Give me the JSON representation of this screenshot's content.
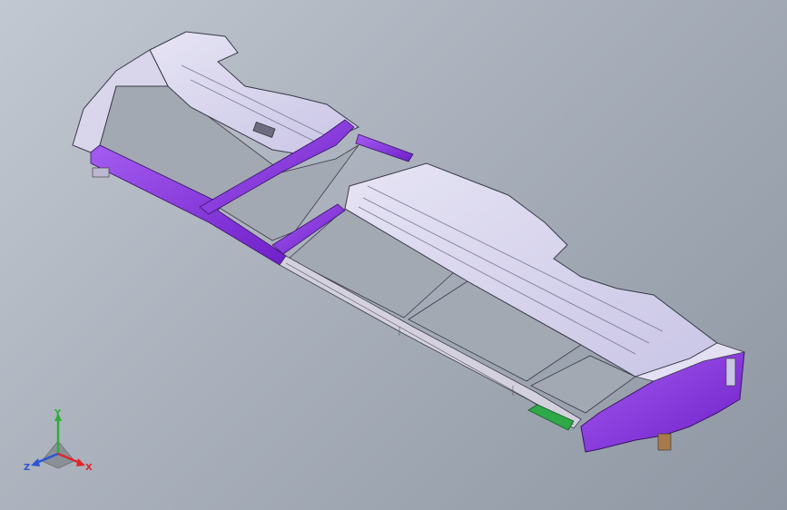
{
  "viewport": {
    "background_top": "#c2c8d1",
    "background_bottom": "#8e97a3",
    "model": {
      "body_color": "#cfcbea",
      "frame_color": "#8b2be2",
      "glass_color": "#9aa1ab",
      "highlight_color": "#2fa84a",
      "edge_color": "#3a3a4a"
    }
  },
  "triad": {
    "x_label": "X",
    "y_label": "Y",
    "z_label": "Z",
    "x_color": "#e0262b",
    "y_color": "#2fae3a",
    "z_color": "#2b55d6"
  }
}
